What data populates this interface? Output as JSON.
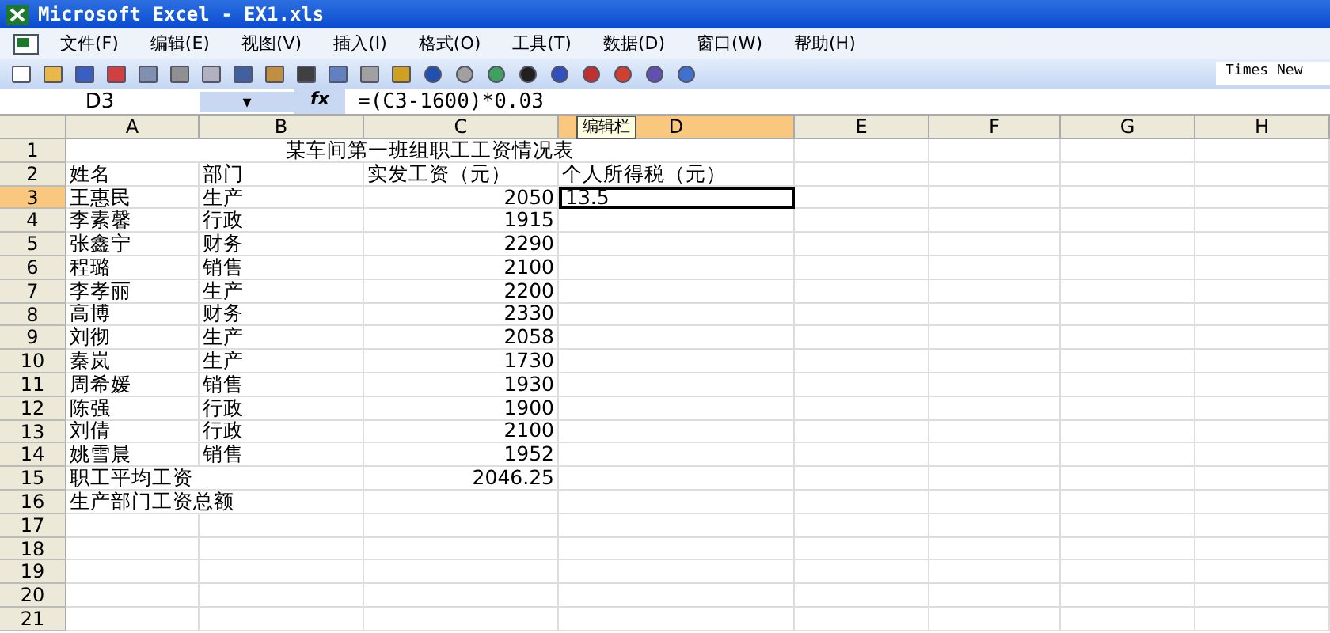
{
  "window": {
    "title": "Microsoft Excel - EX1.xls"
  },
  "menu": [
    "文件(F)",
    "编辑(E)",
    "视图(V)",
    "插入(I)",
    "格式(O)",
    "工具(T)",
    "数据(D)",
    "窗口(W)",
    "帮助(H)"
  ],
  "toolbar": {
    "font_name": "Times New"
  },
  "formula_bar": {
    "name_box": "D3",
    "dropdown": "▾",
    "fx": "fx",
    "formula": "=(C3-1600)*0.03",
    "tooltip": "编辑栏"
  },
  "columns": [
    {
      "label": "A",
      "selected": false
    },
    {
      "label": "B",
      "selected": false
    },
    {
      "label": "C",
      "selected": false
    },
    {
      "label": "D",
      "selected": true
    },
    {
      "label": "E",
      "selected": false
    },
    {
      "label": "F",
      "selected": false
    },
    {
      "label": "G",
      "selected": false
    },
    {
      "label": "H",
      "selected": false
    }
  ],
  "rows": [
    {
      "number": "1",
      "selected": false,
      "kind": "title",
      "cells": [
        "某车间第一班组职工工资情况表"
      ]
    },
    {
      "number": "2",
      "selected": false,
      "kind": "header",
      "cells": [
        "姓名",
        "部门",
        "实发工资（元）",
        "个人所得税（元）"
      ]
    },
    {
      "number": "3",
      "selected": true,
      "kind": "data",
      "cells": [
        "王惠民",
        "生产",
        "2050",
        "13.5"
      ]
    },
    {
      "number": "4",
      "selected": false,
      "kind": "data",
      "cells": [
        "李素馨",
        "行政",
        "1915"
      ]
    },
    {
      "number": "5",
      "selected": false,
      "kind": "data",
      "cells": [
        "张鑫宁",
        "财务",
        "2290"
      ]
    },
    {
      "number": "6",
      "selected": false,
      "kind": "data",
      "cells": [
        "程璐",
        "销售",
        "2100"
      ]
    },
    {
      "number": "7",
      "selected": false,
      "kind": "data",
      "cells": [
        "李孝丽",
        "生产",
        "2200"
      ]
    },
    {
      "number": "8",
      "selected": false,
      "kind": "data",
      "cells": [
        "高博",
        "财务",
        "2330"
      ]
    },
    {
      "number": "9",
      "selected": false,
      "kind": "data",
      "cells": [
        "刘彻",
        "生产",
        "2058"
      ]
    },
    {
      "number": "10",
      "selected": false,
      "kind": "data",
      "cells": [
        "秦岚",
        "生产",
        "1730"
      ]
    },
    {
      "number": "11",
      "selected": false,
      "kind": "data",
      "cells": [
        "周希媛",
        "销售",
        "1930"
      ]
    },
    {
      "number": "12",
      "selected": false,
      "kind": "data",
      "cells": [
        "陈强",
        "行政",
        "1900"
      ]
    },
    {
      "number": "13",
      "selected": false,
      "kind": "data",
      "cells": [
        "刘倩",
        "行政",
        "2100"
      ]
    },
    {
      "number": "14",
      "selected": false,
      "kind": "data",
      "cells": [
        "姚雪晨",
        "销售",
        "1952"
      ]
    },
    {
      "number": "15",
      "selected": false,
      "kind": "summary",
      "cells": [
        "职工平均工资",
        "2046.25"
      ]
    },
    {
      "number": "16",
      "selected": false,
      "kind": "summary",
      "cells": [
        "生产部门工资总额"
      ]
    },
    {
      "number": "17",
      "selected": false,
      "kind": "data",
      "cells": []
    },
    {
      "number": "18",
      "selected": false,
      "kind": "data",
      "cells": []
    },
    {
      "number": "19",
      "selected": false,
      "kind": "data",
      "cells": []
    },
    {
      "number": "20",
      "selected": false,
      "kind": "data",
      "cells": []
    },
    {
      "number": "21",
      "selected": false,
      "kind": "data",
      "cells": []
    }
  ]
}
